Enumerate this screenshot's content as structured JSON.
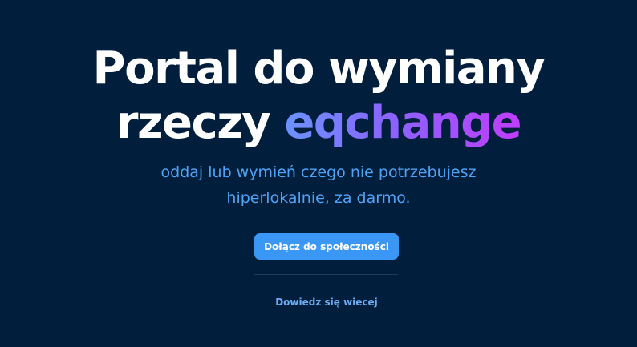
{
  "hero": {
    "title_line1": "Portal do wymiany",
    "title_line2_prefix": "rzeczy ",
    "title_brand": "eqchange",
    "subtitle_line1": "oddaj lub wymień czego nie potrzebujesz",
    "subtitle_line2": "hiperlokalnie, za darmo.",
    "cta_label": "Dołącz do społeczności",
    "more_label": "Dowiedz się wiecej"
  },
  "colors": {
    "background": "#011e3d",
    "title": "#ffffff",
    "brand_gradient_start": "#6c93ff",
    "brand_gradient_end": "#c13cff",
    "subtitle": "#4fa3f5",
    "cta_background": "#3b97f6",
    "link": "#6aaef5"
  }
}
